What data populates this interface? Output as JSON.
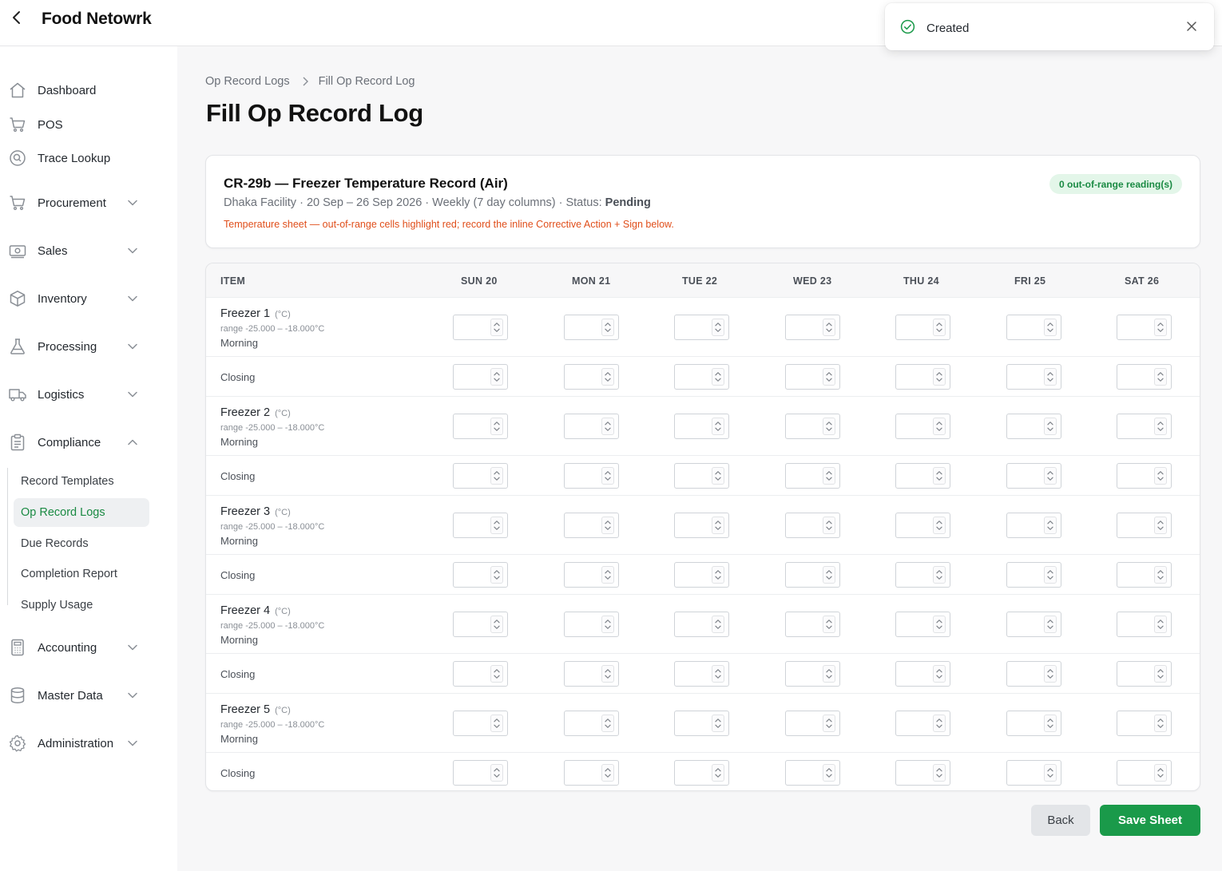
{
  "app": {
    "title": "Food Netowrk"
  },
  "sidebar": {
    "items": [
      {
        "label": "Dashboard",
        "icon": "home-icon"
      },
      {
        "label": "POS",
        "icon": "cart-icon"
      },
      {
        "label": "Trace Lookup",
        "icon": "search-circle-icon"
      },
      {
        "label": "Procurement",
        "icon": "cart-icon",
        "expandable": true
      },
      {
        "label": "Sales",
        "icon": "cash-icon",
        "expandable": true
      },
      {
        "label": "Inventory",
        "icon": "box-icon",
        "expandable": true
      },
      {
        "label": "Processing",
        "icon": "flask-icon",
        "expandable": true
      },
      {
        "label": "Logistics",
        "icon": "truck-icon",
        "expandable": true
      },
      {
        "label": "Compliance",
        "icon": "clipboard-icon",
        "expanded": true
      },
      {
        "label": "Accounting",
        "icon": "calculator-icon",
        "expandable": true
      },
      {
        "label": "Master Data",
        "icon": "database-icon",
        "expandable": true
      },
      {
        "label": "Administration",
        "icon": "gear-icon",
        "expandable": true
      }
    ],
    "compliance_sub": [
      {
        "label": "Record Templates"
      },
      {
        "label": "Op Record Logs",
        "active": true
      },
      {
        "label": "Due Records"
      },
      {
        "label": "Completion Report"
      },
      {
        "label": "Supply Usage"
      }
    ]
  },
  "breadcrumb": {
    "parent": "Op Record Logs",
    "current": "Fill Op Record Log"
  },
  "page": {
    "title": "Fill Op Record Log"
  },
  "record": {
    "title": "CR-29b — Freezer Temperature Record (Air)",
    "meta": "Dhaka Facility · 20 Sep – 26 Sep 2026 · Weekly (7 day columns) · Status: ",
    "status": "Pending",
    "note": "Temperature sheet — out-of-range cells highlight red; record the inline Corrective Action + Sign below.",
    "badge": "0 out-of-range reading(s)"
  },
  "grid": {
    "item_header": "ITEM",
    "days": [
      "SUN 20",
      "MON 21",
      "TUE 22",
      "WED 23",
      "THU 24",
      "FRI 25",
      "SAT 26"
    ],
    "items": [
      {
        "name": "Freezer 1",
        "unit": "(°C)",
        "range": "range -25.000 – -18.000°C",
        "shift1": "Morning",
        "shift2": "Closing"
      },
      {
        "name": "Freezer 2",
        "unit": "(°C)",
        "range": "range -25.000 – -18.000°C",
        "shift1": "Morning",
        "shift2": "Closing"
      },
      {
        "name": "Freezer 3",
        "unit": "(°C)",
        "range": "range -25.000 – -18.000°C",
        "shift1": "Morning",
        "shift2": "Closing"
      },
      {
        "name": "Freezer 4",
        "unit": "(°C)",
        "range": "range -25.000 – -18.000°C",
        "shift1": "Morning",
        "shift2": "Closing"
      },
      {
        "name": "Freezer 5",
        "unit": "(°C)",
        "range": "range -25.000 – -18.000°C",
        "shift1": "Morning",
        "shift2": "Closing"
      }
    ]
  },
  "actions": {
    "back": "Back",
    "save": "Save Sheet"
  },
  "toast": {
    "text": "Created"
  },
  "colors": {
    "accent": "#1a9a4a",
    "active_text": "#1a8a43",
    "note": "#e04e1a",
    "badge_bg": "#e3f6e9"
  }
}
